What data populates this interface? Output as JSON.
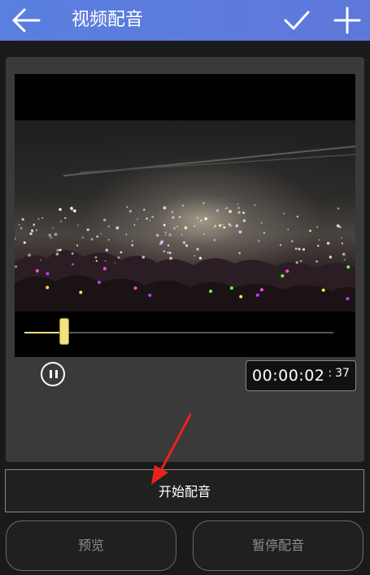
{
  "header": {
    "title": "视频配音",
    "back_icon": "arrow-left-icon",
    "confirm_icon": "check-icon",
    "add_icon": "plus-icon",
    "background_color": "#5a7fe0"
  },
  "player": {
    "progress_fraction": 0.13,
    "time_main": "00:00:02",
    "time_separator": ":",
    "time_fraction": "37",
    "play_state_icon": "pause-icon",
    "slider_color": "#f5e27c"
  },
  "actions": {
    "start_dubbing": "开始配音",
    "preview": "预览",
    "pause_dubbing": "暂停配音"
  },
  "annotation": {
    "arrow_color": "#e8231c"
  }
}
